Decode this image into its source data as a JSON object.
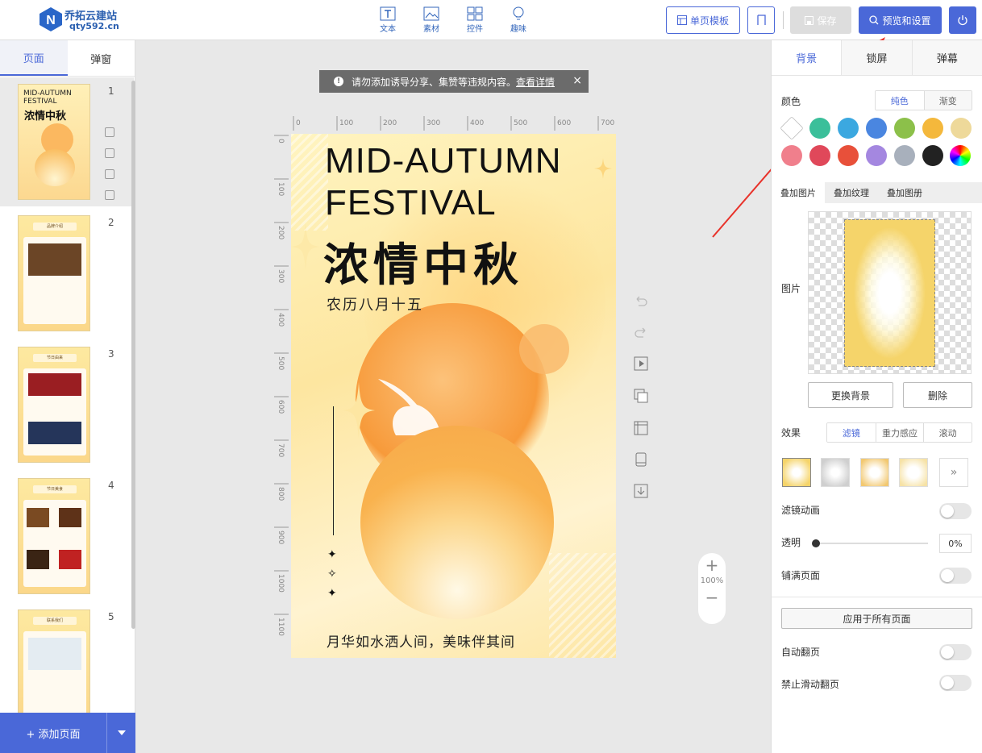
{
  "brand": {
    "name": "乔拓云建站",
    "domain": "qty592.cn"
  },
  "toolbar": {
    "tools": [
      {
        "label": "文本",
        "icon": "text-icon"
      },
      {
        "label": "素材",
        "icon": "image-icon"
      },
      {
        "label": "控件",
        "icon": "widgets-icon"
      },
      {
        "label": "趣味",
        "icon": "lightbulb-icon"
      }
    ],
    "template_label": "单页模板",
    "music_icon": "music-icon",
    "save_label": "保存",
    "preview_label": "预览和设置",
    "power_icon": "power-icon"
  },
  "left_panel": {
    "tabs": [
      "页面",
      "弹窗"
    ],
    "active_tab": "页面",
    "pages": [
      {
        "number": "1"
      },
      {
        "number": "2",
        "title": "品牌介绍"
      },
      {
        "number": "3",
        "title": "节日由来"
      },
      {
        "number": "4",
        "title": "节日美食"
      },
      {
        "number": "5",
        "title": "联系我们"
      }
    ],
    "add_page_label": "+ 添加页面"
  },
  "notice": {
    "text": "请勿添加诱导分享、集赞等违规内容。",
    "link": "查看详情"
  },
  "rulers": {
    "horizontal": [
      "0",
      "100",
      "200",
      "300",
      "400",
      "500",
      "600",
      "700"
    ],
    "vertical": [
      "0",
      "100",
      "200",
      "300",
      "400",
      "500",
      "600",
      "700",
      "800",
      "900",
      "1000",
      "1100"
    ]
  },
  "poster": {
    "title_line1": "MID-AUTUMN",
    "title_line2": "FESTIVAL",
    "chinese_title": "浓情中秋",
    "date": "农历八月十五",
    "footer": "月华如水洒人间，美味伴其间"
  },
  "zoom": {
    "level": "100%"
  },
  "right_panel": {
    "tabs": [
      "背景",
      "锁屏",
      "弹幕"
    ],
    "active_tab": "背景",
    "color_label": "颜色",
    "color_modes": [
      "纯色",
      "渐变"
    ],
    "colors": [
      "#ffffff",
      "#3bbf9a",
      "#3ba8e0",
      "#4a86e0",
      "#8cc04a",
      "#f4b83c",
      "#eed99a",
      "#f07f8c",
      "#e0485a",
      "#e8503a",
      "#a487e0",
      "#a8b0bc",
      "#222222"
    ],
    "overlay_tabs": [
      "叠加图片",
      "叠加纹理",
      "叠加图册"
    ],
    "image_label": "图片",
    "replace_bg": "更换背景",
    "delete": "删除",
    "effect_label": "效果",
    "effect_modes": [
      "滤镜",
      "重力感应",
      "滚动"
    ],
    "filter_more": "»",
    "filter_anim": "滤镜动画",
    "opacity_label": "透明",
    "opacity_value": "0%",
    "fill_page": "铺满页面",
    "apply_all": "应用于所有页面",
    "auto_flip": "自动翻页",
    "disable_swipe": "禁止滑动翻页"
  }
}
